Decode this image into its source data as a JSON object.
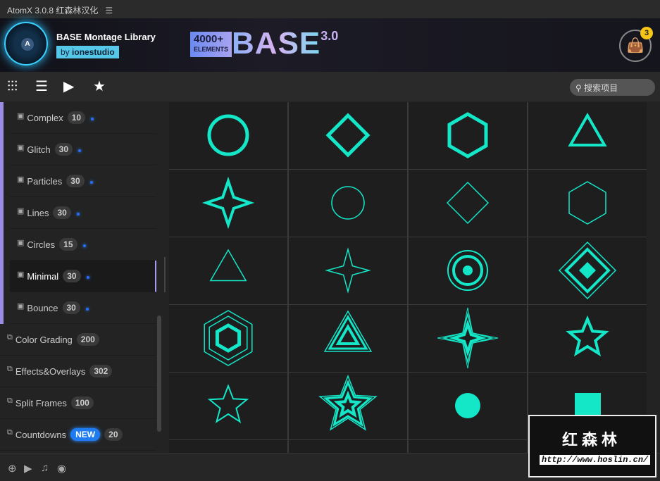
{
  "app": {
    "title": "AtomX 3.0.8 红森林汉化",
    "menu_icon": "hamburger-icon"
  },
  "banner": {
    "library_title": "BASE Montage Library",
    "by_prefix": "by",
    "by_author": "ionestudio",
    "promo_count": "4000+",
    "promo_elements": "ELEMENTS",
    "promo_name": "BASE",
    "promo_version": "3.0",
    "cart_count": "3"
  },
  "toolbar": {
    "search_placeholder": "搜索项目"
  },
  "sidebar": {
    "children": [
      {
        "label": "Complex",
        "count": "10"
      },
      {
        "label": "Glitch",
        "count": "30"
      },
      {
        "label": "Particles",
        "count": "30"
      },
      {
        "label": "Lines",
        "count": "30"
      },
      {
        "label": "Circles",
        "count": "15"
      },
      {
        "label": "Minimal",
        "count": "30",
        "active": true
      },
      {
        "label": "Bounce",
        "count": "30"
      }
    ],
    "parents": [
      {
        "label": "Color Grading",
        "count": "200"
      },
      {
        "label": "Effects&Overlays",
        "count": "302"
      },
      {
        "label": "Split Frames",
        "count": "100"
      },
      {
        "label": "Countdowns",
        "count": "20",
        "badge": "NEW"
      }
    ]
  },
  "grid": {
    "color": "#14e6c8",
    "items": [
      "circle-thick",
      "diamond-thick",
      "hexagon-thick",
      "triangle-thick",
      "star4-thick",
      "circle-thin",
      "diamond-thin",
      "hexagon-thin",
      "triangle-thin",
      "star4-thin",
      "circles-concentric",
      "diamonds-nested",
      "hexagons-nested",
      "triangles-nested",
      "star4-nested",
      "star5-thick",
      "star5-thin",
      "star5-nested",
      "circle-filled",
      "square-filled",
      "blank",
      "blank",
      "blank",
      "blank"
    ]
  },
  "watermark": {
    "title": "红森林",
    "url": "http://www.hoslin.cn/"
  }
}
